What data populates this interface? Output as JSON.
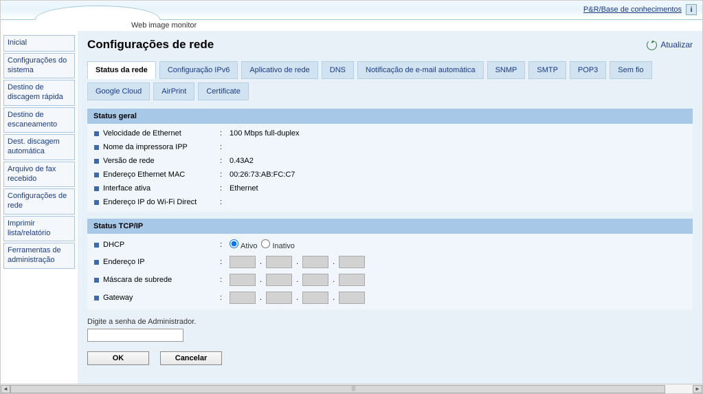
{
  "header": {
    "kb_link": "P&R/Base de conhecimentos",
    "brand": "Web image monitor"
  },
  "sidebar": {
    "items": [
      {
        "label": "Inicial"
      },
      {
        "label": "Configurações do sistema"
      },
      {
        "label": "Destino de discagem rápida"
      },
      {
        "label": "Destino de escaneamento"
      },
      {
        "label": "Dest. discagem automática"
      },
      {
        "label": "Arquivo de fax recebido"
      },
      {
        "label": "Configurações de rede"
      },
      {
        "label": "Imprimir lista/relatório"
      },
      {
        "label": "Ferramentas de administração"
      }
    ]
  },
  "page": {
    "title": "Configurações de rede",
    "refresh_label": "Atualizar"
  },
  "tabs": [
    {
      "label": "Status da rede",
      "active": true
    },
    {
      "label": "Configuração IPv6"
    },
    {
      "label": "Aplicativo de rede"
    },
    {
      "label": "DNS"
    },
    {
      "label": "Notificação de e-mail automática"
    },
    {
      "label": "SNMP"
    },
    {
      "label": "SMTP"
    },
    {
      "label": "POP3"
    },
    {
      "label": "Sem fio"
    },
    {
      "label": "Google Cloud"
    },
    {
      "label": "AirPrint"
    },
    {
      "label": "Certificate"
    }
  ],
  "general": {
    "heading": "Status geral",
    "rows": [
      {
        "label": "Velocidade de Ethernet",
        "value": "100 Mbps full-duplex"
      },
      {
        "label": "Nome da impressora IPP",
        "value": ""
      },
      {
        "label": "Versão de rede",
        "value": "0.43A2"
      },
      {
        "label": "Endereço Ethernet MAC",
        "value": "00:26:73:AB:FC:C7"
      },
      {
        "label": "Interface ativa",
        "value": "Ethernet"
      },
      {
        "label": "Endereço IP do Wi-Fi Direct",
        "value": ""
      }
    ]
  },
  "tcpip": {
    "heading": "Status TCP/IP",
    "dhcp": {
      "label": "DHCP",
      "on": "Ativo",
      "off": "Inativo",
      "value": "Ativo"
    },
    "ip": {
      "label": "Endereço IP",
      "oct": [
        "",
        "",
        "",
        ""
      ]
    },
    "mask": {
      "label": "Máscara de subrede",
      "oct": [
        "",
        "",
        "",
        ""
      ]
    },
    "gw": {
      "label": "Gateway",
      "oct": [
        "",
        "",
        "",
        ""
      ]
    }
  },
  "admin": {
    "label": "Digite a senha de Administrador.",
    "value": ""
  },
  "buttons": {
    "ok": "OK",
    "cancel": "Cancelar"
  }
}
